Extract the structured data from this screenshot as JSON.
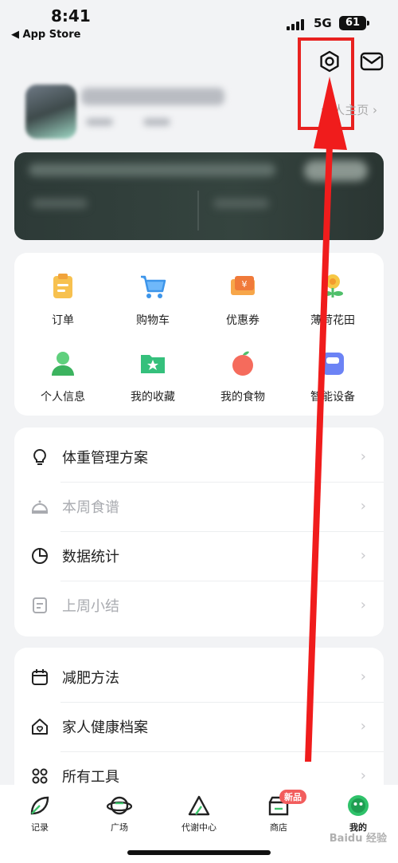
{
  "status_bar": {
    "time": "8:41",
    "back_app": "◀ App Store",
    "network": "5G",
    "battery": "61"
  },
  "header": {
    "settings_icon": "gear-icon",
    "message_icon": "mail-icon"
  },
  "profile": {
    "homepage_label": "个人主页 ›"
  },
  "quick_grid": [
    {
      "label": "订单",
      "icon": "clipboard-icon",
      "color": "#f6b93b"
    },
    {
      "label": "购物车",
      "icon": "cart-icon",
      "color": "#4da6f7"
    },
    {
      "label": "优惠券",
      "icon": "coupon-icon",
      "color": "#f7933b"
    },
    {
      "label": "薄荷花田",
      "icon": "flower-icon",
      "color": "#f4c23e"
    },
    {
      "label": "个人信息",
      "icon": "person-icon",
      "color": "#4cc56c"
    },
    {
      "label": "我的收藏",
      "icon": "folder-star-icon",
      "color": "#38c07a"
    },
    {
      "label": "我的食物",
      "icon": "apple-icon",
      "color": "#f46b5e"
    },
    {
      "label": "智能设备",
      "icon": "scale-icon",
      "color": "#6c83f5"
    }
  ],
  "menu_group_1": [
    {
      "label": "体重管理方案",
      "icon": "bulb-icon",
      "dim": false
    },
    {
      "label": "本周食谱",
      "icon": "cloche-icon",
      "dim": true
    },
    {
      "label": "数据统计",
      "icon": "pie-chart-icon",
      "dim": false
    },
    {
      "label": "上周小结",
      "icon": "note-icon",
      "dim": true
    }
  ],
  "menu_group_2": [
    {
      "label": "减肥方法",
      "icon": "calendar-icon"
    },
    {
      "label": "家人健康档案",
      "icon": "house-heart-icon"
    },
    {
      "label": "所有工具",
      "icon": "grid-icon"
    }
  ],
  "tabbar": [
    {
      "label": "记录",
      "icon": "leaf-icon"
    },
    {
      "label": "广场",
      "icon": "planet-icon"
    },
    {
      "label": "代谢中心",
      "icon": "triangle-icon"
    },
    {
      "label": "商店",
      "icon": "store-icon",
      "badge": "新品"
    },
    {
      "label": "我的",
      "icon": "face-icon",
      "active": true
    }
  ],
  "watermark": "Baidu 经验"
}
